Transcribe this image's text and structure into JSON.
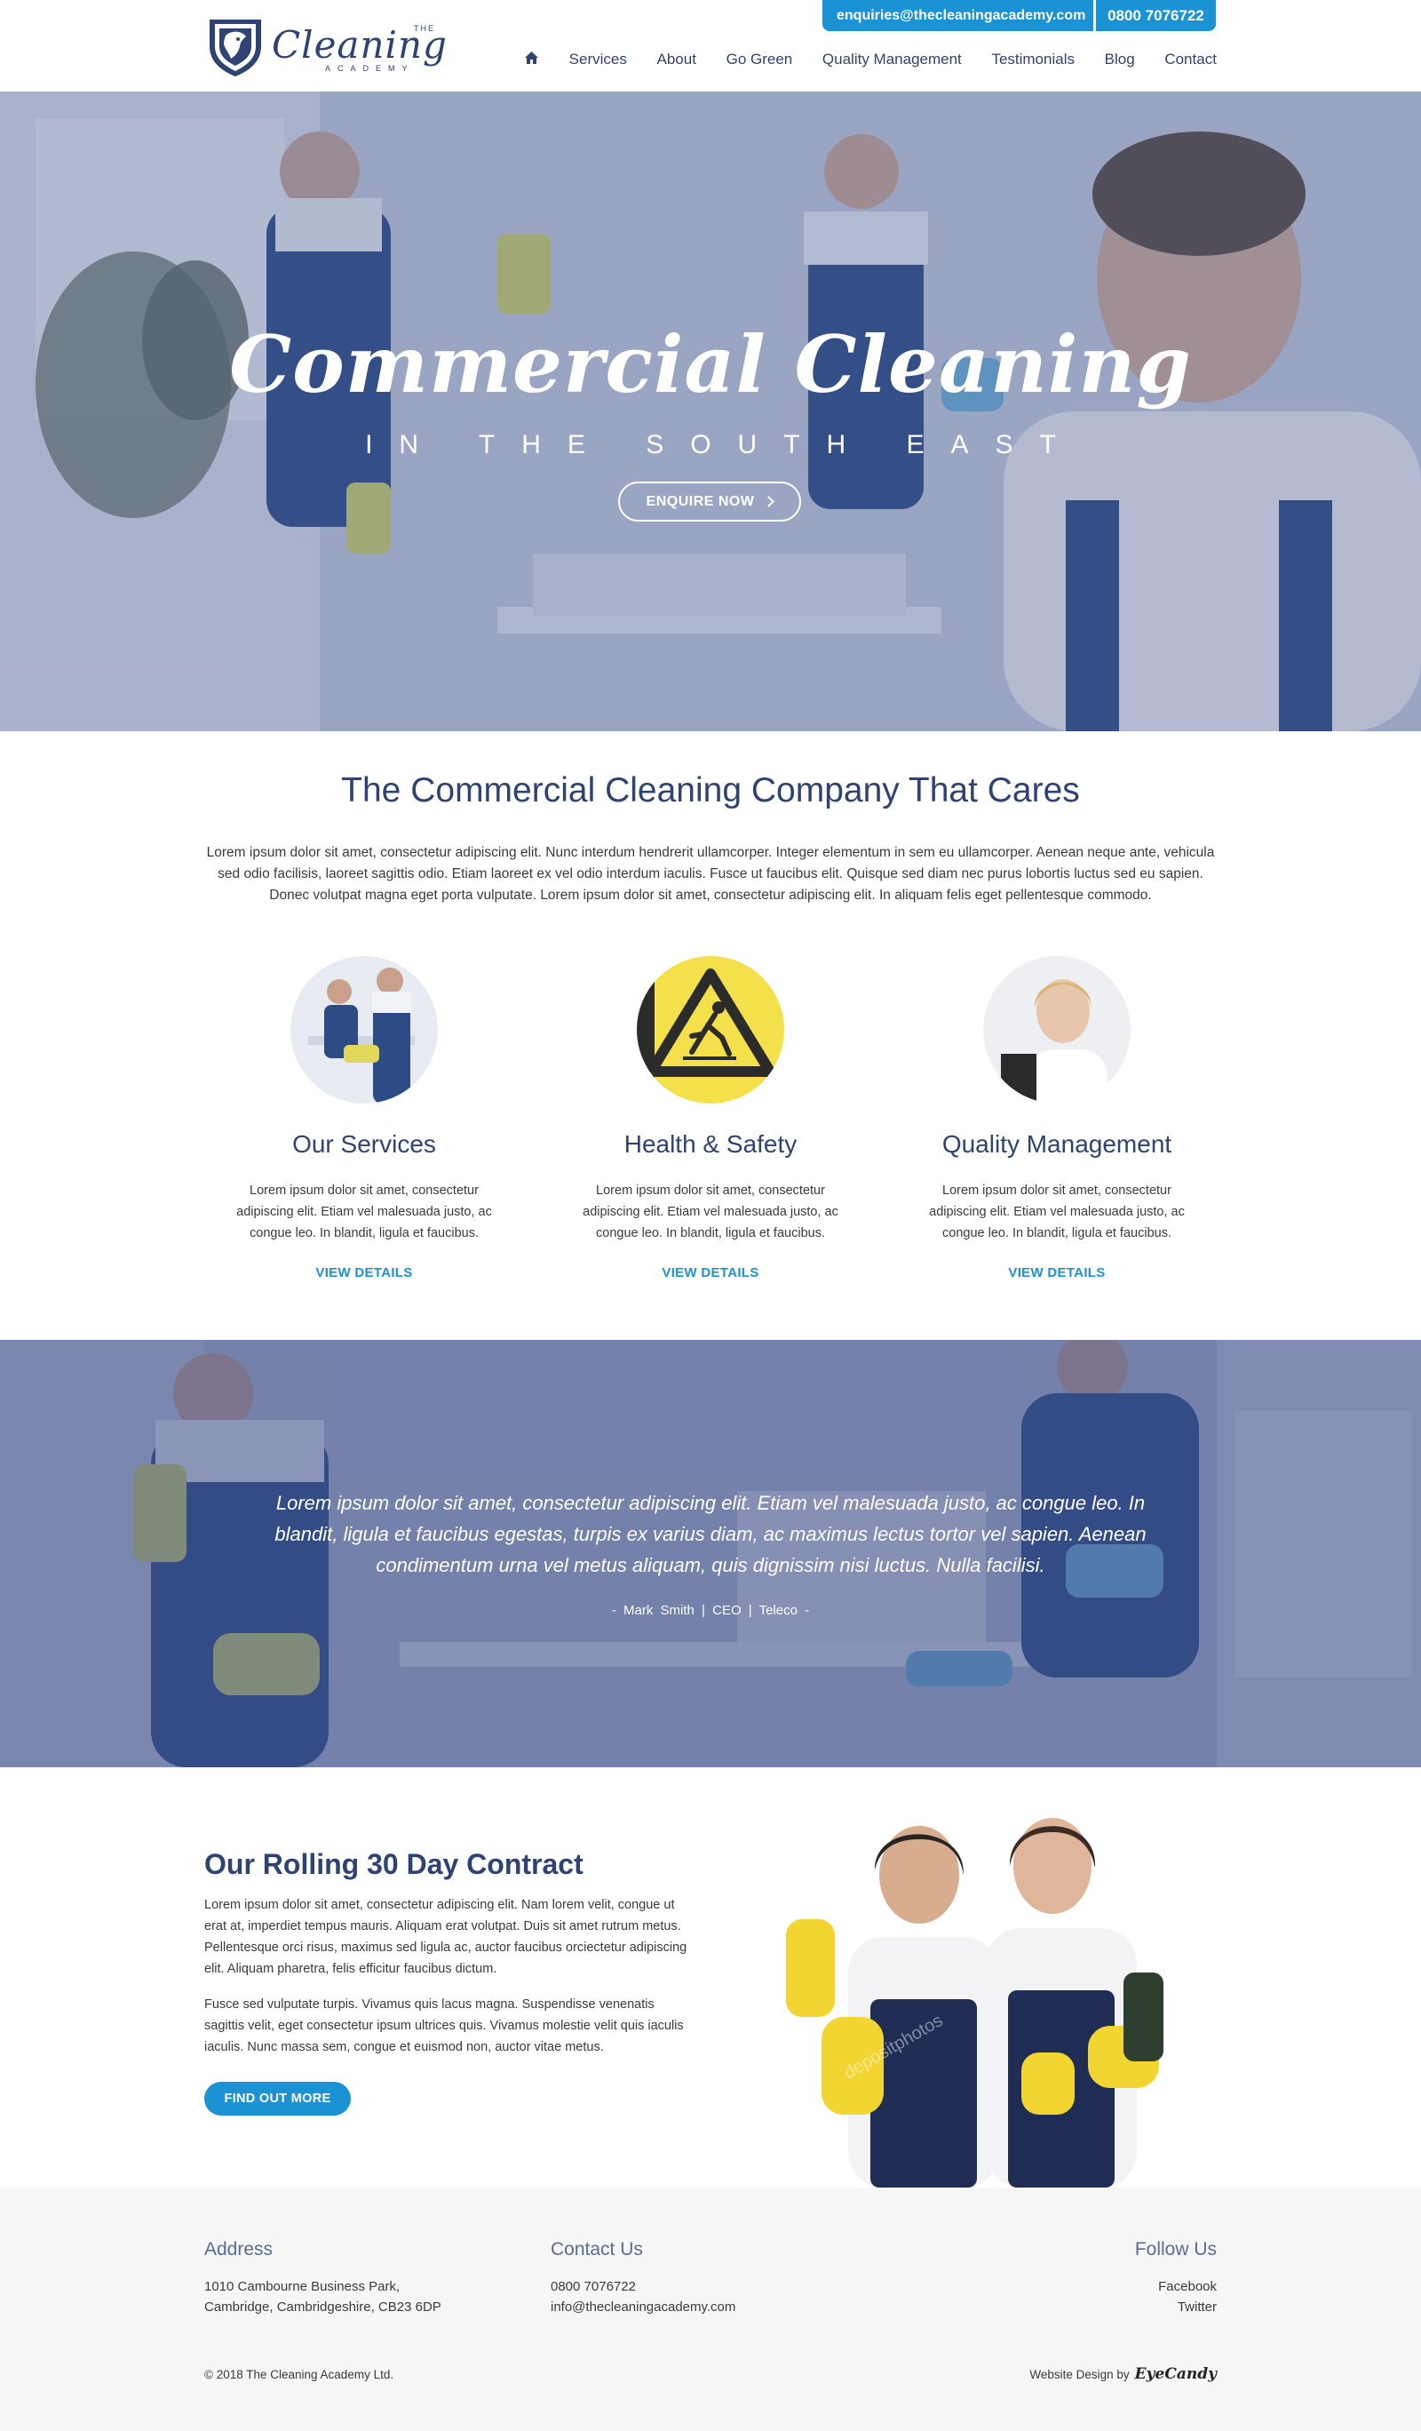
{
  "header": {
    "logo": {
      "the": "THE",
      "main": "Cleaning",
      "sub": "ACADEMY"
    },
    "email": "enquiries@thecleaningacademy.com",
    "phone": "0800 7076722",
    "nav": [
      "Services",
      "About",
      "Go Green",
      "Quality Management",
      "Testimonials",
      "Blog",
      "Contact"
    ]
  },
  "hero": {
    "title": "Commercial Cleaning",
    "subtitle": "IN THE SOUTH EAST",
    "button": "ENQUIRE NOW"
  },
  "intro": {
    "title": "The Commercial Cleaning Company That Cares",
    "text": "Lorem ipsum dolor sit amet, consectetur adipiscing elit. Nunc interdum hendrerit ullamcorper. Integer elementum in sem eu ullamcorper. Aenean neque ante, vehicula sed odio facilisis, laoreet sagittis odio. Etiam laoreet ex vel odio interdum iaculis. Fusce ut faucibus elit. Quisque sed diam nec purus lobortis luctus sed eu sapien. Donec volutpat magna eget porta vulputate. Lorem ipsum dolor sit amet, consectetur adipiscing elit. In aliquam felis eget pellentesque commodo."
  },
  "features": [
    {
      "title": "Our Services",
      "text": "Lorem ipsum dolor sit amet, consectetur adipiscing elit. Etiam vel malesuada justo, ac congue leo. In blandit, ligula et faucibus.",
      "link": "VIEW DETAILS"
    },
    {
      "title": "Health & Safety",
      "text": "Lorem ipsum dolor sit amet, consectetur adipiscing elit. Etiam vel malesuada justo, ac congue leo. In blandit, ligula et faucibus.",
      "link": "VIEW DETAILS"
    },
    {
      "title": "Quality Management",
      "text": "Lorem ipsum dolor sit amet, consectetur adipiscing elit. Etiam vel malesuada justo, ac congue leo. In blandit, ligula et faucibus.",
      "link": "VIEW DETAILS"
    }
  ],
  "testimonial": {
    "quote": "Lorem ipsum dolor sit amet, consectetur adipiscing elit. Etiam vel malesuada justo, ac congue leo. In blandit, ligula et faucibus egestas, turpis ex varius diam, ac maximus lectus tortor vel sapien. Aenean condimentum urna vel metus aliquam, quis dignissim nisi luctus. Nulla facilisi.",
    "cite": "- Mark Smith | CEO | Teleco -"
  },
  "contract": {
    "title": "Our Rolling 30 Day Contract",
    "p1": "Lorem ipsum dolor sit amet, consectetur adipiscing elit. Nam lorem velit, congue ut erat at, imperdiet tempus mauris. Aliquam erat volutpat. Duis sit amet rutrum metus. Pellentesque orci risus, maximus sed ligula ac, auctor faucibus orciectetur adipiscing elit. Aliquam pharetra, felis efficitur faucibus dictum.",
    "p2": "Fusce sed vulputate turpis. Vivamus quis lacus magna. Suspendisse venenatis sagittis velit, eget consectetur ipsum ultrices quis. Vivamus molestie velit quis iaculis iaculis. Nunc massa sem, congue et euismod non, auctor vitae metus.",
    "button": "FIND OUT MORE",
    "watermark": "depositphotos"
  },
  "footer": {
    "address_title": "Address",
    "address_line1": "1010 Cambourne Business Park,",
    "address_line2": "Cambridge, Cambridgeshire, CB23 6DP",
    "contact_title": "Contact Us",
    "contact_phone": "0800 7076722",
    "contact_email": "info@thecleaningacademy.com",
    "follow_title": "Follow Us",
    "facebook": "Facebook",
    "twitter": "Twitter",
    "copyright": "© 2018  The Cleaning Academy Ltd.",
    "credit_label": "Website Design by",
    "credit_brand": "EyeCandy"
  },
  "colors": {
    "brand_blue": "#1a92d4",
    "navy": "#2f4372",
    "footer_bg": "#f6f6f6"
  },
  "icons": [
    "home-icon",
    "chevron-right-icon",
    "lion-shield-logo-icon",
    "wet-floor-warning-icon"
  ]
}
